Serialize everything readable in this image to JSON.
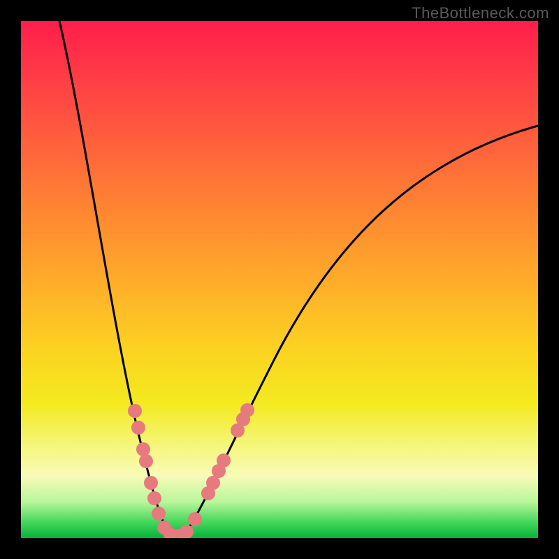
{
  "watermark": "TheBottleneck.com",
  "chart_data": {
    "type": "line",
    "title": "",
    "xlabel": "",
    "ylabel": "",
    "xlim": [
      0,
      100
    ],
    "ylim": [
      0,
      100
    ],
    "background_gradient": {
      "orientation": "vertical",
      "stops": [
        {
          "pos": 0.0,
          "color": "#ff1e4b"
        },
        {
          "pos": 0.5,
          "color": "#ffab2a"
        },
        {
          "pos": 0.75,
          "color": "#f3ea1f"
        },
        {
          "pos": 1.0,
          "color": "#07b23a"
        }
      ]
    },
    "series": [
      {
        "name": "curve",
        "note": "V-shaped profile; values estimated from pixel position (0=bottom=optimal, 100=top=worst)",
        "x": [
          7,
          12,
          17,
          22,
          26,
          28,
          30,
          32,
          36,
          40,
          46,
          55,
          70,
          85,
          100
        ],
        "y": [
          100,
          70,
          42,
          20,
          8,
          2,
          0,
          2,
          10,
          22,
          36,
          52,
          70,
          78,
          80
        ]
      }
    ],
    "scatter": {
      "name": "marked-points",
      "color": "#e67a7e",
      "note": "pink sample dots along the curve near the trough; approximate positions",
      "x": [
        22,
        23,
        24,
        24.5,
        25.3,
        25.9,
        26.7,
        27.8,
        29,
        30.4,
        32,
        33.7,
        36.2,
        37.1,
        38.2,
        39.2,
        41.9,
        43,
        43.8
      ],
      "y": [
        24.6,
        21.4,
        17.2,
        14.9,
        10.7,
        7.7,
        4.7,
        2.0,
        0.7,
        0.4,
        1.2,
        3.6,
        8.6,
        10.7,
        13.0,
        15.0,
        20.8,
        23.0,
        24.7
      ]
    }
  }
}
